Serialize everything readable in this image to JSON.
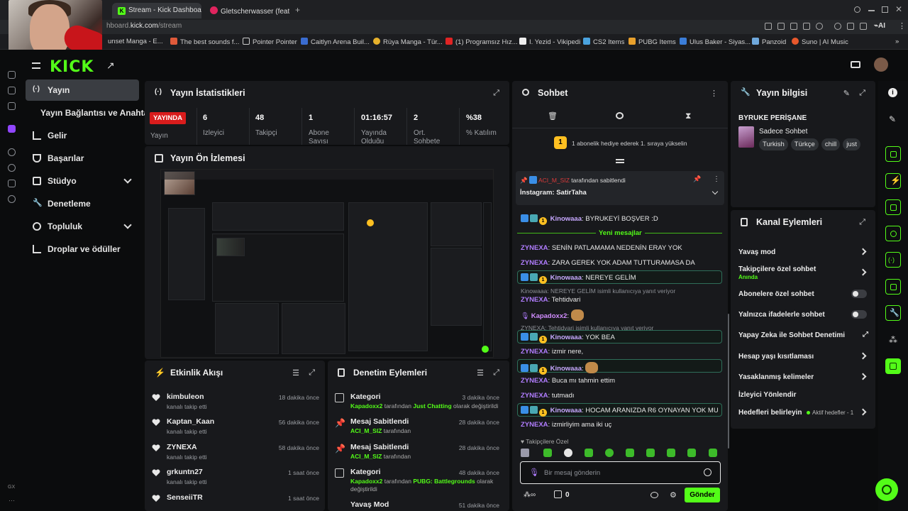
{
  "browser": {
    "tabs": [
      {
        "label": "Stream - Kick Dashboard",
        "active": true
      },
      {
        "label": "Gletscherwasser (feat",
        "active": false
      }
    ],
    "url_prefix": "hboard.",
    "url_domain": "kick.com",
    "url_path": "/stream",
    "bookmarks": [
      "unset Manga - E...",
      "The best sounds f...",
      "Pointer Pointer",
      "Caitlyn Arena Buil...",
      "Rüya Manga - Tür...",
      "(1) Programsız Hız...",
      "I. Yezid - Vikipedi",
      "CS2 Items",
      "PUBG Items",
      "Ulus Baker - Siyas...",
      "Panzoid",
      "Suno | AI Music"
    ],
    "ai_label": "AI"
  },
  "sidebar": {
    "items": [
      {
        "label": "Yayın",
        "active": true
      },
      {
        "label": "Yayın Bağlantısı ve Anahtarı"
      },
      {
        "label": "Gelir"
      },
      {
        "label": "Başarılar"
      },
      {
        "label": "Stüdyo"
      },
      {
        "label": "Denetleme"
      },
      {
        "label": "Topluluk"
      },
      {
        "label": "Droplar ve ödüller"
      }
    ],
    "bottom_label": "GX"
  },
  "stats": {
    "title": "Yayın İstatistikleri",
    "live_badge": "YAYINDA",
    "live_label": "Yayın",
    "items": [
      {
        "value": "6",
        "label": "İzleyici"
      },
      {
        "value": "48",
        "label": "Takipçi"
      },
      {
        "value": "1",
        "label": "Abone Sayısı"
      },
      {
        "value": "01:16:57",
        "label": "Yayında Olduğu"
      },
      {
        "value": "2",
        "label": "Ort. Sohbete"
      },
      {
        "value": "%38",
        "label": "% Katılım"
      }
    ]
  },
  "preview": {
    "title": "Yayın Ön İzlemesi"
  },
  "activity": {
    "title": "Etkinlik Akışı",
    "items": [
      {
        "name": "kimbuleon",
        "sub": "kanalı takip etti",
        "time": "18 dakika önce"
      },
      {
        "name": "Kaptan_Kaan",
        "sub": "kanalı takip etti",
        "time": "56 dakika önce"
      },
      {
        "name": "ZYNEXA",
        "sub": "kanalı takip etti",
        "time": "58 dakika önce"
      },
      {
        "name": "grkuntn27",
        "sub": "kanalı takip etti",
        "time": "1 saat önce"
      },
      {
        "name": "SenseiiTR",
        "sub": "",
        "time": "1 saat önce"
      }
    ]
  },
  "moderation": {
    "title": "Denetim Eylemleri",
    "items": [
      {
        "title": "Kategori",
        "time": "3 dakika önce",
        "user": "Kapadoxx2",
        "mid": " tarafından ",
        "target": "Just Chatting",
        "end": " olarak değiştirildi"
      },
      {
        "title": "Mesaj Sabitlendi",
        "time": "28 dakika önce",
        "user": "ACI_M_SIZ",
        "mid": " tarafından",
        "target": "",
        "end": ""
      },
      {
        "title": "Mesaj Sabitlendi",
        "time": "28 dakika önce",
        "user": "ACI_M_SIZ",
        "mid": " tarafından",
        "target": "",
        "end": ""
      },
      {
        "title": "Kategori",
        "time": "48 dakika önce",
        "user": "Kapadoxx2",
        "mid": " tarafından ",
        "target": "PUBG: Battlegrounds",
        "end": " olarak değiştirildi"
      },
      {
        "title": "Yavaş Mod",
        "time": "51 dakika önce",
        "user": "",
        "mid": "",
        "target": "",
        "end": ""
      }
    ]
  },
  "chat": {
    "title": "Sohbet",
    "sub_notice": "1 abonelik hediye ederek 1. sıraya yükselin",
    "sub_rank": "1",
    "pinned": {
      "user": "ACI_M_SIZ",
      "by": " tarafından sabitlendi",
      "text": "İnstagram: SatirTaha"
    },
    "new_messages": "Yeni mesajlar",
    "messages": [
      {
        "user": "Kinowaaa",
        "text": "BYRUKEYİ BOŞVER :D"
      },
      {
        "user": "ZYNEXA",
        "text": "SENİN PATLAMAMA NEDENİN ERAY YOK"
      },
      {
        "user": "ZYNEXA",
        "text": "ZARA GEREK YOK ADAM TUTTURAMASA DA"
      },
      {
        "user": "Kinowaaa",
        "text": "NEREYE GELİM"
      },
      {
        "reply": "Kinowaaa: NEREYE GELİM isimli kullanıcıya yanıt veriyor"
      },
      {
        "user": "ZYNEXA",
        "text": "Tehtidvari"
      },
      {
        "user": "Kapadoxx2",
        "text": ""
      },
      {
        "reply": "ZYNEXA: Tehtidvari isimli kullanıcıya yanıt veriyor"
      },
      {
        "user": "Kinowaaa",
        "text": "YOK BEA"
      },
      {
        "user": "ZYNEXA",
        "text": "izmir nere,"
      },
      {
        "user": "Kinowaaa",
        "text": ""
      },
      {
        "user": "ZYNEXA",
        "text": "Buca mı tahmin ettim"
      },
      {
        "user": "ZYNEXA",
        "text": "tutmadı"
      },
      {
        "user": "Kinowaaa",
        "text": "HOCAM ARANIZDA R6 OYNAYAN YOK MU"
      },
      {
        "user": "ZYNEXA",
        "text": "izmirliyim ama iki uç"
      }
    ],
    "followers_only": "Takipçilere Özel",
    "input_placeholder": "Bir mesaj gönderin",
    "points": "0",
    "send": "Gönder"
  },
  "stream_info": {
    "title": "Yayın bilgisi",
    "stream_title": "BYRUKE PERİŞANE",
    "category": "Sadece Sohbet",
    "tags": [
      "Turkish",
      "Türkçe",
      "chill",
      "just"
    ]
  },
  "channel_actions": {
    "title": "Kanal Eylemleri",
    "items": [
      {
        "label": "Yavaş mod",
        "kind": "chevron"
      },
      {
        "label": "Takipçilere özel sohbet",
        "sub": "Anında",
        "kind": "chevron"
      },
      {
        "label": "Abonelere özel sohbet",
        "kind": "toggle"
      },
      {
        "label": "Yalnızca ifadelerle sohbet",
        "kind": "toggle"
      },
      {
        "label": "Yapay Zeka ile Sohbet Denetimi",
        "kind": "external"
      },
      {
        "label": "Hesap yaşı kısıtlaması",
        "kind": "chevron"
      },
      {
        "label": "Yasaklanmış kelimeler",
        "kind": "chevron"
      },
      {
        "label": "İzleyici Yönlendir",
        "kind": "none"
      },
      {
        "label": "Hedefleri belirleyin",
        "sub": "Aktif hedefler - 1",
        "kind": "chevron"
      }
    ]
  },
  "colors": {
    "accent": "#53fc18",
    "live": "#d91c1c",
    "panel": "#18191c",
    "bg": "#0b0c0d"
  }
}
